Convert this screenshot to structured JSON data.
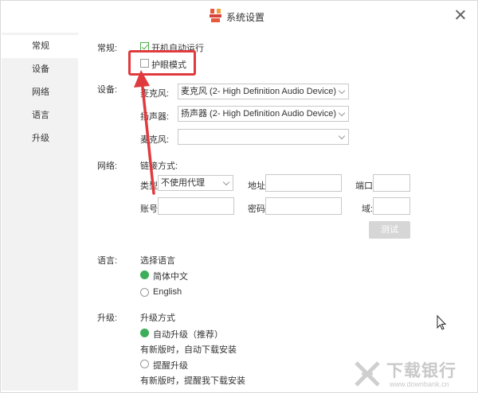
{
  "window": {
    "title": "系统设置"
  },
  "sidebar": {
    "items": [
      {
        "label": "常规"
      },
      {
        "label": "设备"
      },
      {
        "label": "网络"
      },
      {
        "label": "语言"
      },
      {
        "label": "升级"
      }
    ]
  },
  "general": {
    "section_label": "常规:",
    "autostart_label": "开机自动运行",
    "autostart_checked": true,
    "eyecare_label": "护眼模式",
    "eyecare_checked": false
  },
  "devices": {
    "section_label": "设备:",
    "mic_label": "麦克风:",
    "mic_value": "麦克风 (2- High Definition Audio Device)",
    "speaker_label": "扬声器:",
    "speaker_value": "扬声器 (2- High Definition Audio Device)",
    "mic2_label": "麦克风:",
    "mic2_value": ""
  },
  "network": {
    "section_label": "网络:",
    "connect_mode_label": "链接方式:",
    "type_label": "类型:",
    "type_value": "不使用代理",
    "address_label": "地址:",
    "port_label": "端口:",
    "account_label": "账号:",
    "password_label": "密码:",
    "domain_label": "域:",
    "test_button": "测试"
  },
  "language": {
    "section_label": "语言:",
    "heading": "选择语言",
    "options": [
      {
        "label": "简体中文",
        "selected": true
      },
      {
        "label": "English",
        "selected": false
      }
    ]
  },
  "upgrade": {
    "section_label": "升级:",
    "heading": "升级方式",
    "auto_label": "自动升级（推荐）",
    "auto_selected": true,
    "auto_desc": "有新版时，自动下载安装",
    "remind_label": "提醒升级",
    "remind_selected": false,
    "remind_desc": "有新版时，提醒我下载安装"
  },
  "watermark": {
    "cn": "下载银行",
    "en": "www.downbank.cn"
  },
  "colors": {
    "accent_green": "#3dae5a",
    "annotation_red": "#e03a3e",
    "sidebar_bg": "#f2f2f2"
  }
}
